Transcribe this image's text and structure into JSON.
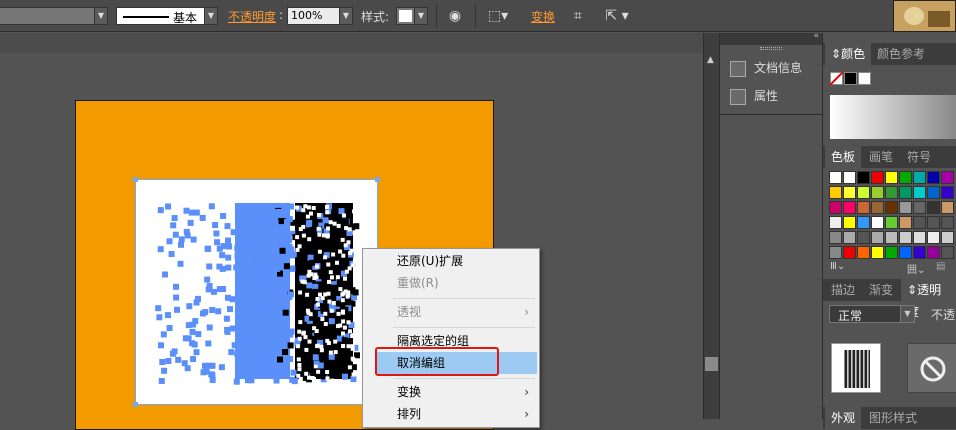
{
  "toolbar": {
    "stroke_style": "基本",
    "opacity_label": "不透明度",
    "opacity_value": "100%",
    "style_label": "样式:",
    "transform_label": "变换"
  },
  "side_panel": {
    "items": [
      {
        "label": "文档信息",
        "icon": "document-info-icon"
      },
      {
        "label": "属性",
        "icon": "attributes-icon"
      }
    ]
  },
  "right_panel": {
    "color_tabs": [
      "颜色",
      "颜色参考"
    ],
    "swatch_tabs": [
      "色板",
      "画笔",
      "符号"
    ],
    "stroke_tabs": [
      "描边",
      "渐变",
      "透明度"
    ],
    "blend_mode": "正常",
    "opacity_short": "不透",
    "bottom_tabs": [
      "外观",
      "图形样式"
    ]
  },
  "context_menu": {
    "items": [
      {
        "label": "还原(U)扩展",
        "disabled": false,
        "submenu": false
      },
      {
        "label": "重做(R)",
        "disabled": true,
        "submenu": false
      },
      {
        "label": "透视",
        "disabled": true,
        "submenu": true
      },
      {
        "label": "隔离选定的组",
        "disabled": false,
        "submenu": false
      },
      {
        "label": "取消编组",
        "disabled": false,
        "submenu": false,
        "highlighted": true
      },
      {
        "label": "变换",
        "disabled": false,
        "submenu": true
      },
      {
        "label": "排列",
        "disabled": false,
        "submenu": true
      }
    ],
    "submenu_glyph": "›"
  },
  "colors": {
    "artboard_bg": "#f39a00",
    "pixel_art": "#5b8ff9",
    "highlight_box": "#e01515",
    "menu_hover": "#9ccaf2"
  }
}
